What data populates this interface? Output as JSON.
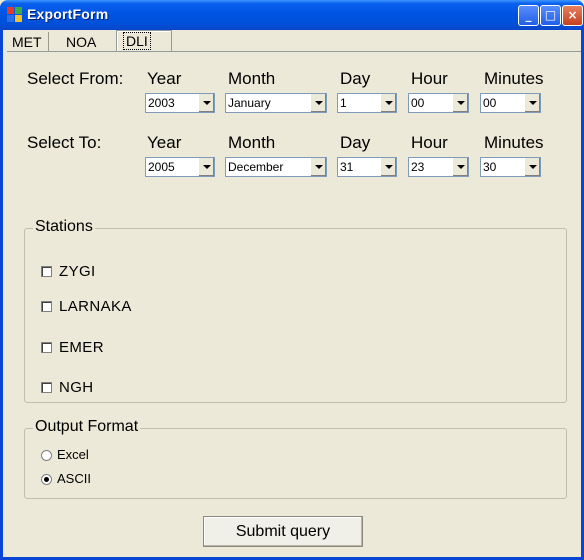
{
  "window": {
    "title": "ExportForm",
    "minimize": "_",
    "maximize": "□",
    "close": "×"
  },
  "tabs": [
    {
      "label": "MET"
    },
    {
      "label": "NOA"
    },
    {
      "label": "DLI",
      "active": true
    }
  ],
  "headers": {
    "year": "Year",
    "month": "Month",
    "day": "Day",
    "hour": "Hour",
    "minutes": "Minutes"
  },
  "from": {
    "label": "Select From:",
    "year": "2003",
    "month": "January",
    "day": "1",
    "hour": "00",
    "minutes": "00"
  },
  "to": {
    "label": "Select To:",
    "year": "2005",
    "month": "December",
    "day": "31",
    "hour": "23",
    "minutes": "30"
  },
  "stations": {
    "title": "Stations",
    "items": [
      {
        "label": "ZYGI",
        "checked": false
      },
      {
        "label": "LARNAKA",
        "checked": false
      },
      {
        "label": "EMER",
        "checked": false
      },
      {
        "label": "NGH",
        "checked": false
      }
    ]
  },
  "output": {
    "title": "Output Format",
    "options": [
      {
        "label": "Excel",
        "selected": false
      },
      {
        "label": "ASCII",
        "selected": true
      }
    ]
  },
  "submit_label": "Submit query",
  "colors": {
    "titlebar": "#0054E3",
    "background": "#ECE9D8",
    "field_border": "#7F9DB9"
  }
}
